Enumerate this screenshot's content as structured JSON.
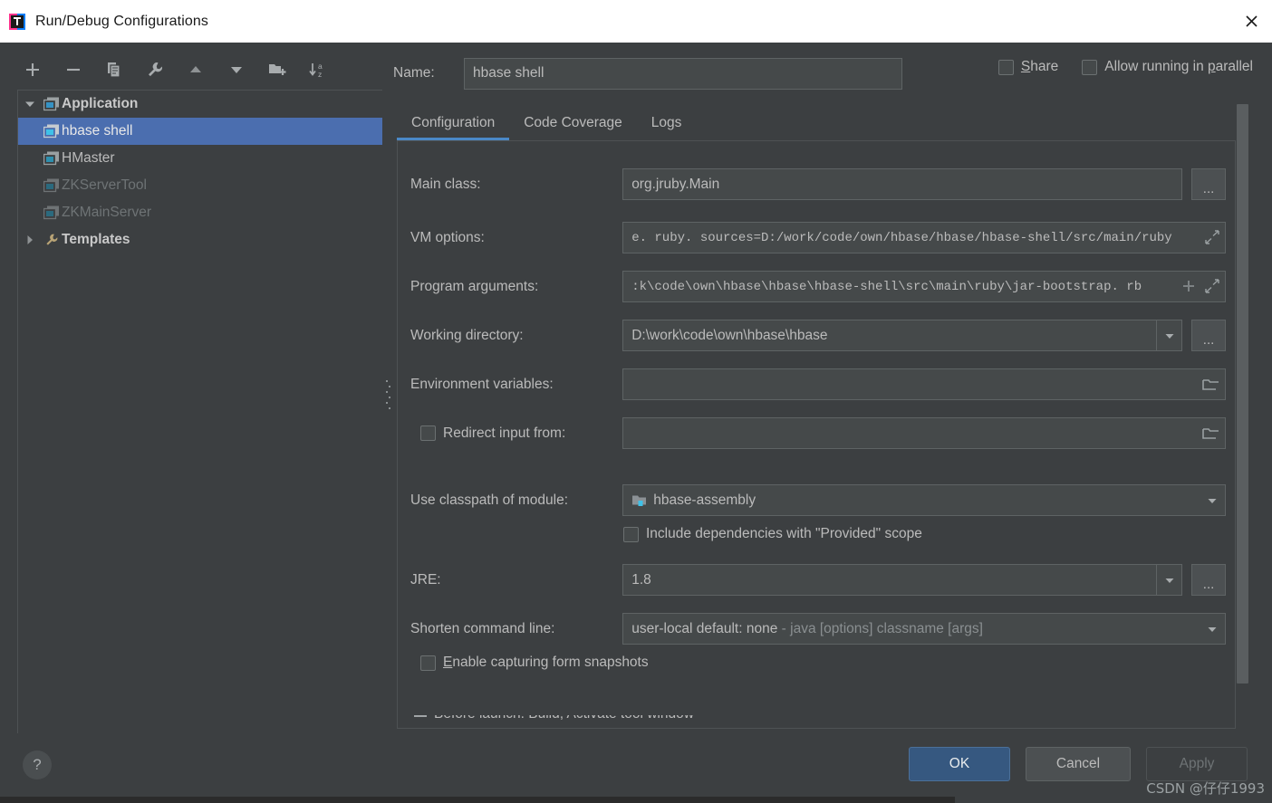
{
  "window": {
    "title": "Run/Debug Configurations",
    "close_label": "✕",
    "app_icon": "intellij-idea-logo"
  },
  "toolbar": {
    "items": [
      {
        "name": "add-configuration",
        "icon": "plus-icon"
      },
      {
        "name": "remove-configuration",
        "icon": "minus-icon"
      },
      {
        "name": "copy-configuration",
        "icon": "copy-icon"
      },
      {
        "name": "edit-templates",
        "icon": "wrench-icon"
      },
      {
        "name": "move-up",
        "icon": "arrow-up-icon"
      },
      {
        "name": "move-down",
        "icon": "arrow-down-icon"
      },
      {
        "name": "create-folder",
        "icon": "new-folder-icon"
      },
      {
        "name": "sort-configurations",
        "icon": "sort-alpha-icon"
      }
    ]
  },
  "tree": {
    "nodes": [
      {
        "label": "Application",
        "icon": "application-icon",
        "twisty": "expanded",
        "level": 0,
        "bold": true,
        "selected": false,
        "dim": false
      },
      {
        "label": "hbase shell",
        "icon": "application-icon",
        "twisty": "none",
        "level": 1,
        "bold": false,
        "selected": true,
        "dim": false
      },
      {
        "label": "HMaster",
        "icon": "application-icon",
        "twisty": "none",
        "level": 1,
        "bold": false,
        "selected": false,
        "dim": false
      },
      {
        "label": "ZKServerTool",
        "icon": "application-icon",
        "twisty": "none",
        "level": 1,
        "bold": false,
        "selected": false,
        "dim": true
      },
      {
        "label": "ZKMainServer",
        "icon": "application-icon",
        "twisty": "none",
        "level": 1,
        "bold": false,
        "selected": false,
        "dim": true
      },
      {
        "label": "Templates",
        "icon": "wrench-icon",
        "twisty": "collapsed",
        "level": 0,
        "bold": true,
        "selected": false,
        "dim": false
      }
    ]
  },
  "name_row": {
    "label": "Name:",
    "value": "hbase shell",
    "share": {
      "label_pre": "",
      "mnemonic": "S",
      "label_post": "hare",
      "checked": false
    },
    "parallel": {
      "label_pre": "Allow running in ",
      "mnemonic": "p",
      "label_post": "arallel",
      "checked": false
    }
  },
  "tabs": [
    {
      "label": "Configuration",
      "active": true
    },
    {
      "label": "Code Coverage",
      "active": false
    },
    {
      "label": "Logs",
      "active": false
    }
  ],
  "form": {
    "main_class": {
      "label": "Main class:",
      "value": "org.jruby.Main",
      "browse": "..."
    },
    "vm_options": {
      "label": "VM options:",
      "value": "e. ruby. sources=D:/work/code/own/hbase/hbase/hbase-shell/src/main/ruby",
      "expand_icon": "expand-icon"
    },
    "program_arguments": {
      "label": "Program arguments:",
      "value": ":k\\code\\own\\hbase\\hbase\\hbase-shell\\src\\main\\ruby\\jar-bootstrap. rb",
      "insert_icon": "plus-icon",
      "expand_icon": "expand-icon"
    },
    "working_directory": {
      "label": "Working directory:",
      "value": "D:\\work\\code\\own\\hbase\\hbase",
      "dropdown_icon": "chevron-down-icon",
      "browse": "..."
    },
    "environment_variables": {
      "label": "Environment variables:",
      "value": "",
      "folder_icon": "folder-icon"
    },
    "redirect_input": {
      "label": "Redirect input from:",
      "value": "",
      "checked": false,
      "folder_icon": "folder-icon"
    },
    "use_classpath": {
      "label": "Use classpath of module:",
      "value": "hbase-assembly",
      "module_icon": "module-folder-icon",
      "dropdown_icon": "chevron-down-icon"
    },
    "include_provided": {
      "label": "Include dependencies with \"Provided\" scope",
      "checked": false
    },
    "jre": {
      "label": "JRE:",
      "value": "1.8",
      "dropdown_icon": "chevron-down-icon",
      "browse": "..."
    },
    "shorten_command_line": {
      "label": "Shorten command line:",
      "value_primary": "user-local default: none",
      "value_secondary": "- java [options] classname [args]",
      "dropdown_icon": "chevron-down-icon"
    },
    "form_snapshots": {
      "label_pre": "",
      "mnemonic": "E",
      "label_post": "nable capturing form snapshots",
      "checked": false
    }
  },
  "before_launch": {
    "label": "Before launch: Build, Activate tool window"
  },
  "footer": {
    "help": "?",
    "ok": "OK",
    "cancel": "Cancel",
    "apply": "Apply"
  },
  "watermark": "CSDN @仔仔1993",
  "colors": {
    "accent_blue": "#4a88c7",
    "selection_blue": "#4b6eaf",
    "primary_button": "#365880",
    "panel_bg": "#3c3f41",
    "field_bg": "#45494a",
    "text": "#bbbbbb",
    "text_dim": "#6e7375",
    "titlebar_bg": "#ffffff"
  }
}
